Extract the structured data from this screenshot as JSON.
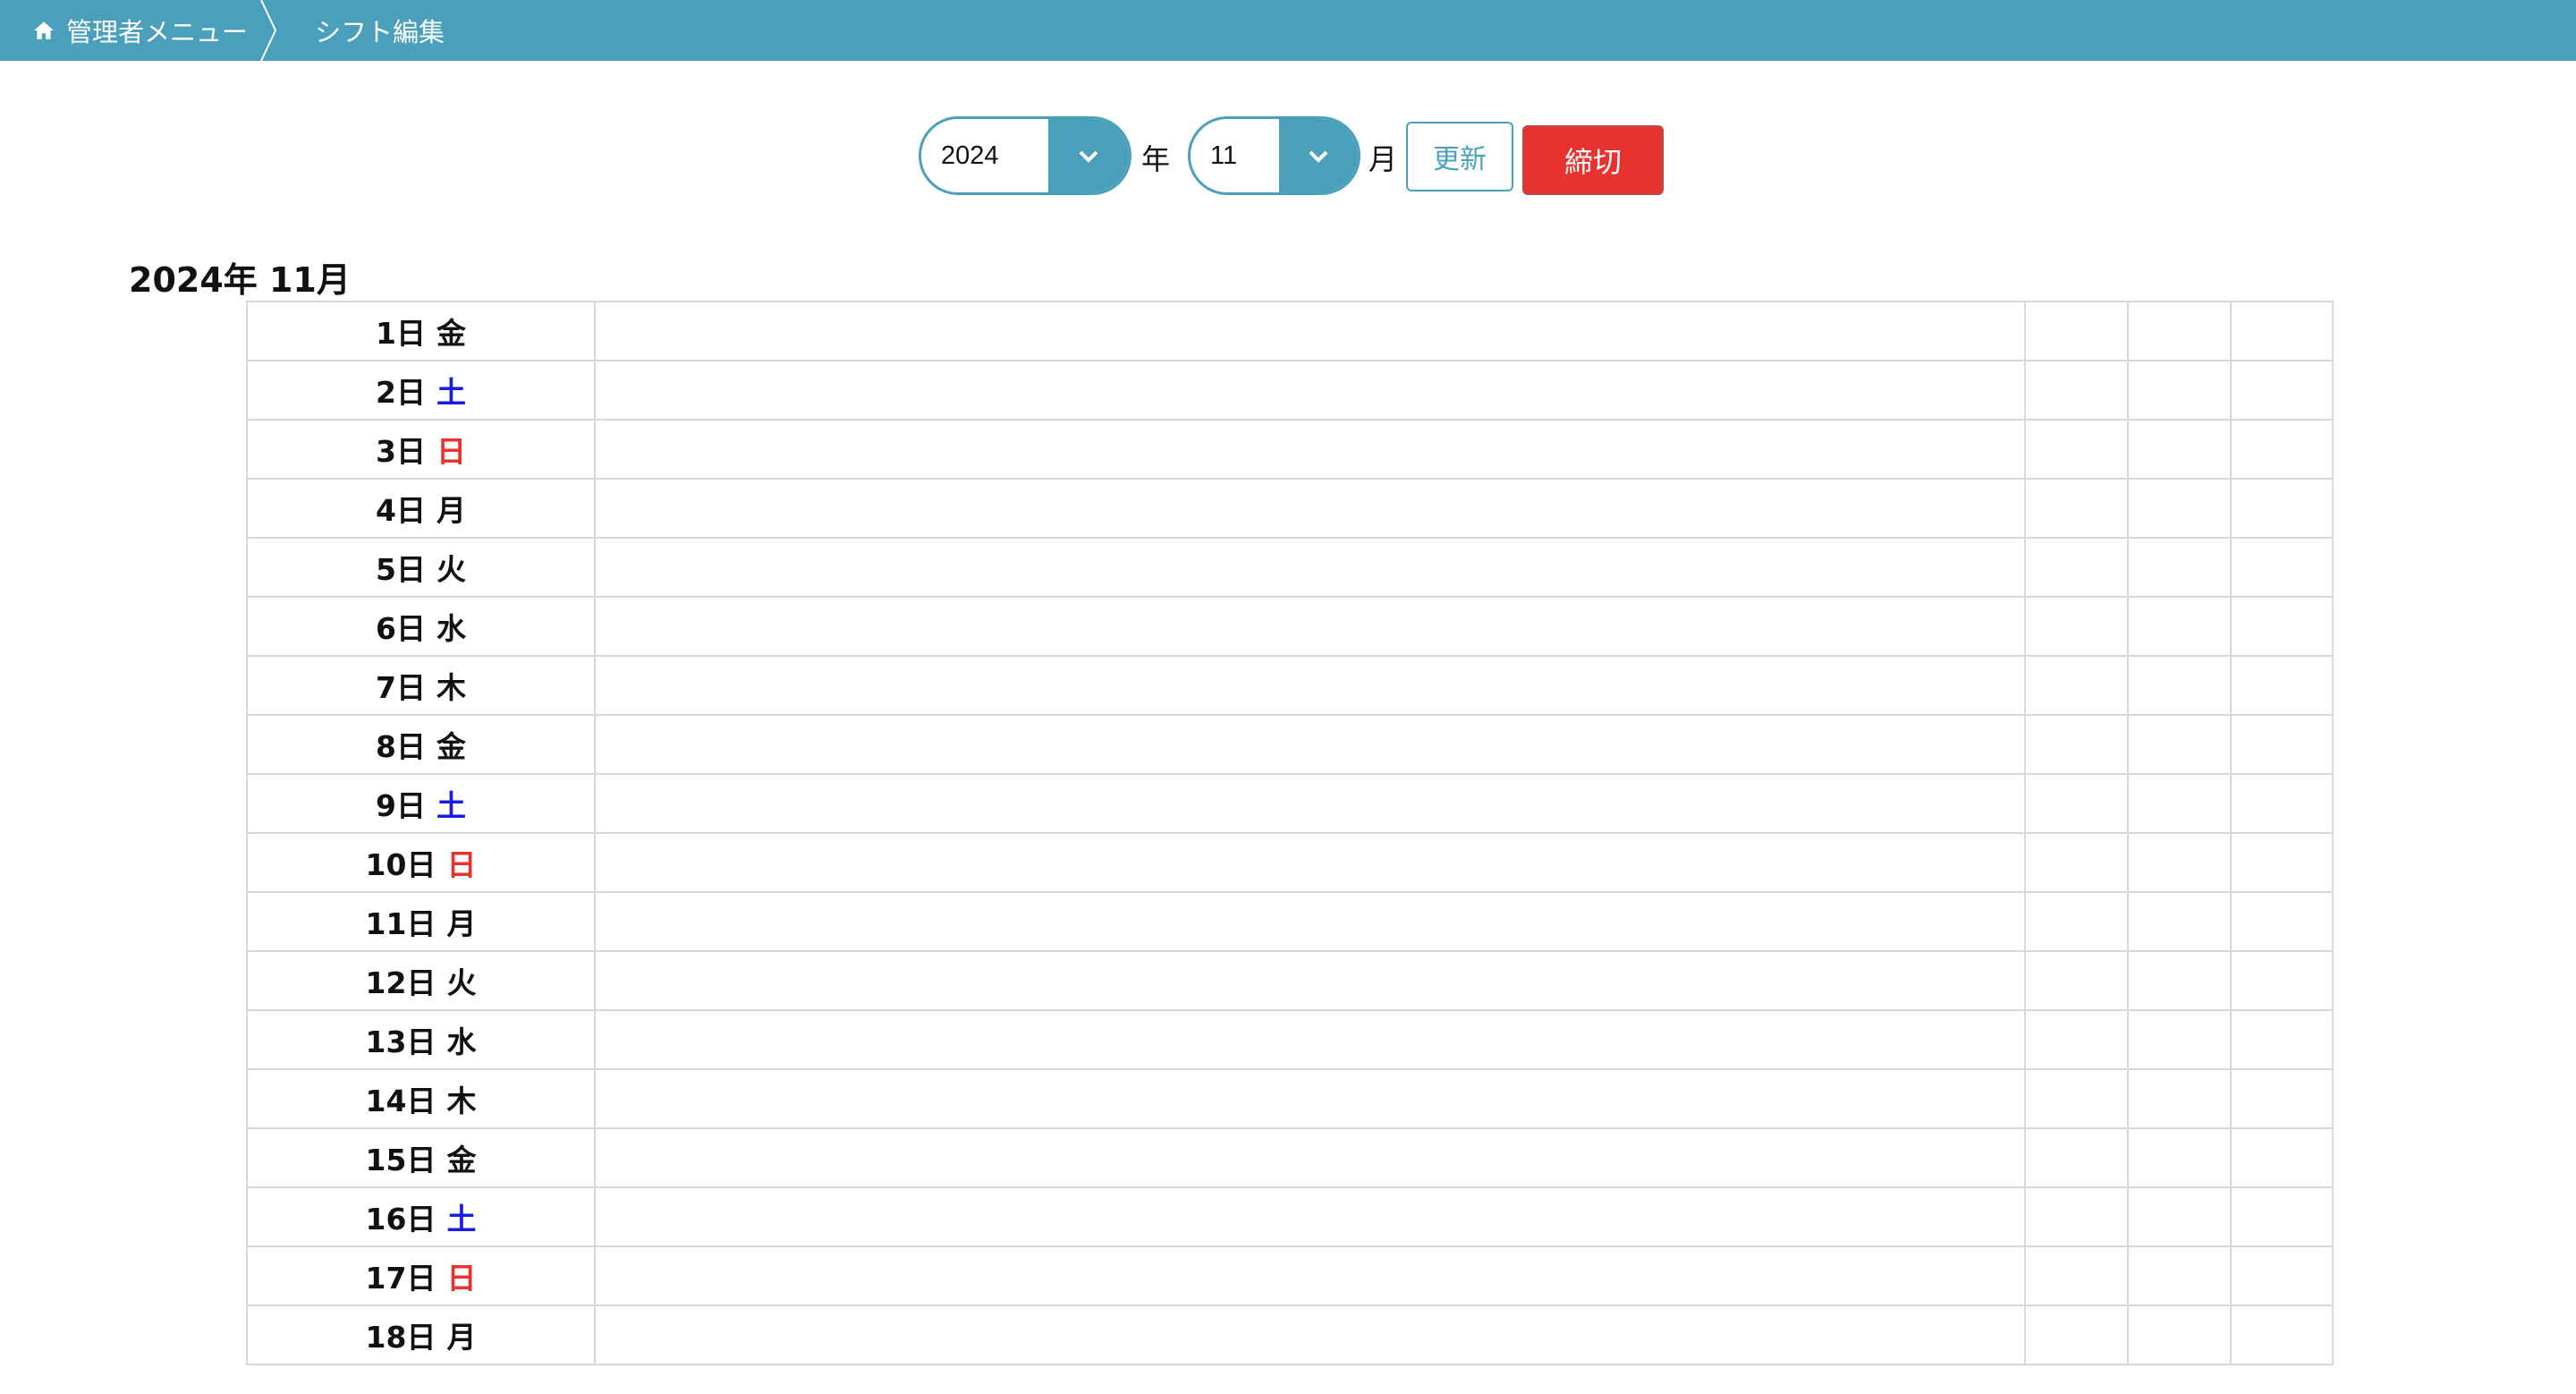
{
  "breadcrumb": {
    "home_label": "管理者メニュー",
    "current_label": "シフト編集"
  },
  "controls": {
    "year_value": "2024",
    "year_unit": "年",
    "month_value": "11",
    "month_unit": "月",
    "update_label": "更新",
    "close_label": "締切"
  },
  "colors": {
    "header": "#4aa0bb",
    "saturday": "#1a1ae0",
    "sunday": "#e8322e",
    "close_button": "#e8322e"
  },
  "month_title": "2024年 11月",
  "days": [
    {
      "day": "1日",
      "dow": "金",
      "type": "weekday"
    },
    {
      "day": "2日",
      "dow": "土",
      "type": "sat"
    },
    {
      "day": "3日",
      "dow": "日",
      "type": "sun"
    },
    {
      "day": "4日",
      "dow": "月",
      "type": "weekday"
    },
    {
      "day": "5日",
      "dow": "火",
      "type": "weekday"
    },
    {
      "day": "6日",
      "dow": "水",
      "type": "weekday"
    },
    {
      "day": "7日",
      "dow": "木",
      "type": "weekday"
    },
    {
      "day": "8日",
      "dow": "金",
      "type": "weekday"
    },
    {
      "day": "9日",
      "dow": "土",
      "type": "sat"
    },
    {
      "day": "10日",
      "dow": "日",
      "type": "sun"
    },
    {
      "day": "11日",
      "dow": "月",
      "type": "weekday"
    },
    {
      "day": "12日",
      "dow": "火",
      "type": "weekday"
    },
    {
      "day": "13日",
      "dow": "水",
      "type": "weekday"
    },
    {
      "day": "14日",
      "dow": "木",
      "type": "weekday"
    },
    {
      "day": "15日",
      "dow": "金",
      "type": "weekday"
    },
    {
      "day": "16日",
      "dow": "土",
      "type": "sat"
    },
    {
      "day": "17日",
      "dow": "日",
      "type": "sun"
    },
    {
      "day": "18日",
      "dow": "月",
      "type": "weekday"
    }
  ]
}
